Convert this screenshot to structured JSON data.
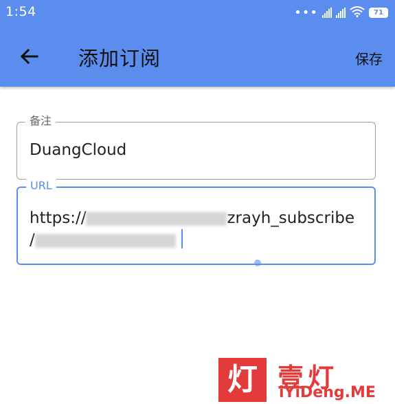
{
  "status_bar": {
    "time": "1:54",
    "battery": "71"
  },
  "toolbar": {
    "title": "添加订阅",
    "save_label": "保存"
  },
  "form": {
    "note_label": "备注",
    "note_value": "DuangCloud",
    "url_label": "URL",
    "url_prefix": "https://",
    "url_visible_mid": "zrayh_subscribe",
    "url_line2_start": "/"
  },
  "watermark": {
    "seal": "灯",
    "name": "壹灯",
    "site": "iYiDeng.ME"
  },
  "colors": {
    "app_bar": "#5b8def",
    "accent": "#5b8def",
    "watermark": "#e33b3b"
  }
}
